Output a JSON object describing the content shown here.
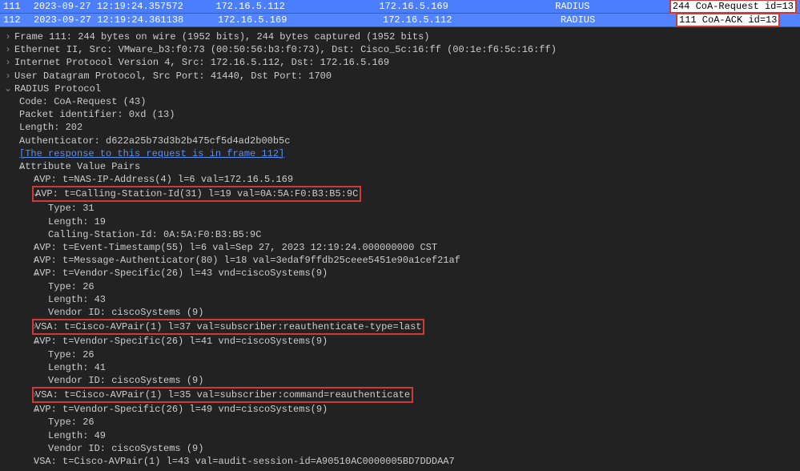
{
  "packet_list": {
    "rows": [
      {
        "no": "111",
        "time": "2023-09-27 12:19:24.357572",
        "src": "172.16.5.112",
        "dst": "172.16.5.169",
        "proto": "RADIUS",
        "info": "244 CoA-Request id=13"
      },
      {
        "no": "112",
        "time": "2023-09-27 12:19:24.361138",
        "src": "172.16.5.169",
        "dst": "172.16.5.112",
        "proto": "RADIUS",
        "info": "111 CoA-ACK id=13"
      }
    ]
  },
  "details": {
    "frame": "Frame 111: 244 bytes on wire (1952 bits), 244 bytes captured (1952 bits)",
    "ethernet": "Ethernet II, Src: VMware_b3:f0:73 (00:50:56:b3:f0:73), Dst: Cisco_5c:16:ff (00:1e:f6:5c:16:ff)",
    "ip": "Internet Protocol Version 4, Src: 172.16.5.112, Dst: 172.16.5.169",
    "udp": "User Datagram Protocol, Src Port: 41440, Dst Port: 1700",
    "radius": {
      "label": "RADIUS Protocol",
      "code": "Code: CoA-Request (43)",
      "packet_id": "Packet identifier: 0xd (13)",
      "length": "Length: 202",
      "authenticator": "Authenticator: d622a25b73d3b2b475cf5d4ad2b00b5c",
      "response_link": "[The response to this request is in frame 112]",
      "avp_label": "Attribute Value Pairs",
      "avps": {
        "nas_ip": "AVP: t=NAS-IP-Address(4) l=6 val=172.16.5.169",
        "calling_station": {
          "header": "AVP: t=Calling-Station-Id(31) l=19 val=0A:5A:F0:B3:B5:9C",
          "type": "Type: 31",
          "length": "Length: 19",
          "value": "Calling-Station-Id: 0A:5A:F0:B3:B5:9C"
        },
        "event_ts": "AVP: t=Event-Timestamp(55) l=6 val=Sep 27, 2023 12:19:24.000000000 CST",
        "msg_auth": "AVP: t=Message-Authenticator(80) l=18 val=3edaf9ffdb25ceee5451e90a1cef21af",
        "vsa1": {
          "header": "AVP: t=Vendor-Specific(26) l=43 vnd=ciscoSystems(9)",
          "type": "Type: 26",
          "length": "Length: 43",
          "vendor": "Vendor ID: ciscoSystems (9)",
          "vsa": "VSA: t=Cisco-AVPair(1) l=37 val=subscriber:reauthenticate-type=last"
        },
        "vsa2": {
          "header": "AVP: t=Vendor-Specific(26) l=41 vnd=ciscoSystems(9)",
          "type": "Type: 26",
          "length": "Length: 41",
          "vendor": "Vendor ID: ciscoSystems (9)",
          "vsa": "VSA: t=Cisco-AVPair(1) l=35 val=subscriber:command=reauthenticate"
        },
        "vsa3": {
          "header": "AVP: t=Vendor-Specific(26) l=49 vnd=ciscoSystems(9)",
          "type": "Type: 26",
          "length": "Length: 49",
          "vendor": "Vendor ID: ciscoSystems (9)",
          "vsa": "VSA: t=Cisco-AVPair(1) l=43 val=audit-session-id=A90510AC0000005BD7DDDAA7"
        }
      }
    }
  },
  "icons": {
    "expanded": "⌄",
    "collapsed": "›"
  }
}
